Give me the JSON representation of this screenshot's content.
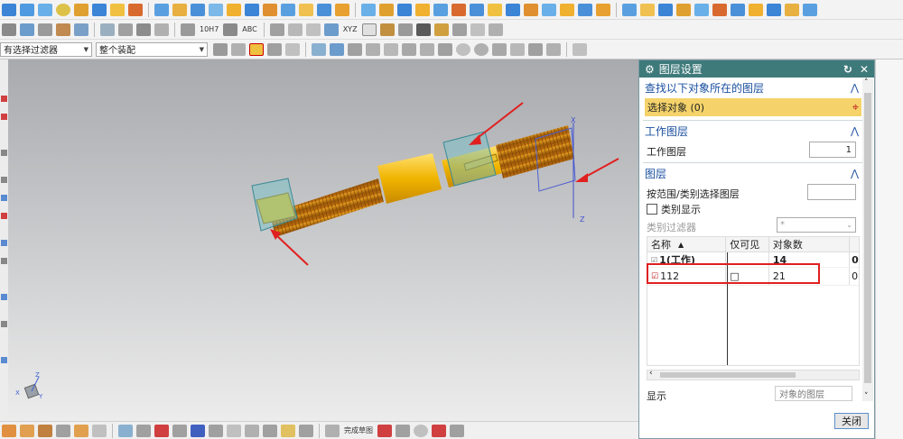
{
  "filters": {
    "selection_filter": "有选择过滤器",
    "assembly_scope": "整个装配"
  },
  "toolbar_text": {
    "fit_label": "10H7",
    "abc_label": "ABC",
    "xyz_label": "XYZ",
    "finish_sketch": "完成草图"
  },
  "dialog": {
    "title": "图层设置",
    "find_section": {
      "title": "查找以下对象所在的图层",
      "select_label": "选择对象 (0)"
    },
    "work_section": {
      "title": "工作图层",
      "label": "工作图层",
      "value": "1"
    },
    "layer_section": {
      "title": "图层",
      "range_label": "按范围/类别选择图层",
      "category_display": "类别显示",
      "category_filter_label": "类别过滤器",
      "category_filter_value": "*",
      "columns": [
        "名称",
        "仅可见",
        "对象数",
        ""
      ],
      "rows": [
        {
          "name": "1(工作)",
          "visible": "",
          "count": "14",
          "extra": "0"
        },
        {
          "name": "112",
          "visible": "□",
          "count": "21",
          "extra": "0"
        }
      ]
    },
    "display_label": "显示",
    "display_value": "对象的图层",
    "close_button": "关闭"
  },
  "colors": {
    "dialog_header": "#3f7a7b",
    "section_title": "#1a4fa0",
    "select_highlight": "#f5d36a",
    "annotation_red": "#e02020",
    "shaft_orange": "#c87a10",
    "shaft_yellow": "#f0b400",
    "bbox_teal": "#6ec0c8"
  },
  "icons": {
    "settings": "gear-icon",
    "reset": "reset-icon",
    "close": "close-icon",
    "collapse": "chevron-up-icon",
    "crosshair": "crosshair-icon",
    "sort": "sort-up-icon",
    "checked": "checkbox-checked-icon",
    "unchecked": "checkbox-unchecked-icon"
  },
  "viewport_triad": {
    "x": "X",
    "y": "Y",
    "z": "Z"
  }
}
